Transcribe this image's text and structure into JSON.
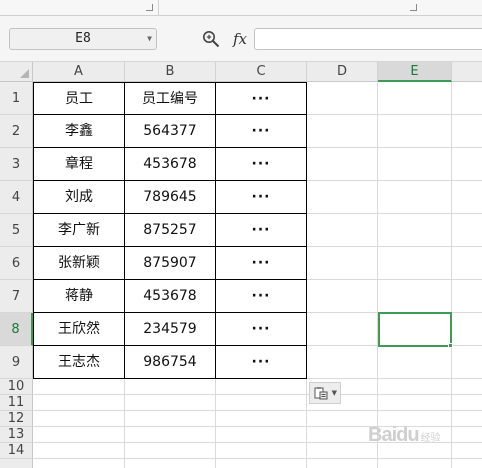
{
  "formula_bar": {
    "cell_reference": "E8",
    "fx_label": "fx",
    "formula_value": ""
  },
  "icons": {
    "name_box_dropdown": "chevron-down-icon",
    "zoom": "magnifier-icon",
    "paste_options": "paste-options-icon"
  },
  "sheet": {
    "column_headers": [
      "A",
      "B",
      "C",
      "D",
      "E"
    ],
    "selected_column": "E",
    "row_headers": [
      "1",
      "2",
      "3",
      "4",
      "5",
      "6",
      "7",
      "8",
      "9",
      "10",
      "11",
      "12",
      "13",
      "14"
    ],
    "selected_row": "8",
    "selected_cell": "E8",
    "table": [
      {
        "name": "员工",
        "id": "员工编号",
        "more": "···"
      },
      {
        "name": "李鑫",
        "id": "564377",
        "more": "···"
      },
      {
        "name": "章程",
        "id": "453678",
        "more": "···"
      },
      {
        "name": "刘成",
        "id": "789645",
        "more": "···"
      },
      {
        "name": "李广新",
        "id": "875257",
        "more": "···"
      },
      {
        "name": "张新颖",
        "id": "875907",
        "more": "···"
      },
      {
        "name": "蒋静",
        "id": "453678",
        "more": "···"
      },
      {
        "name": "王欣然",
        "id": "234579",
        "more": "···"
      },
      {
        "name": "王志杰",
        "id": "986754",
        "more": "···"
      }
    ]
  },
  "colors": {
    "selection": "#3f9a55",
    "header_bg": "#ececec",
    "gridline": "#dadada"
  },
  "watermark": {
    "text": "Baidu",
    "subtext": "经验"
  }
}
